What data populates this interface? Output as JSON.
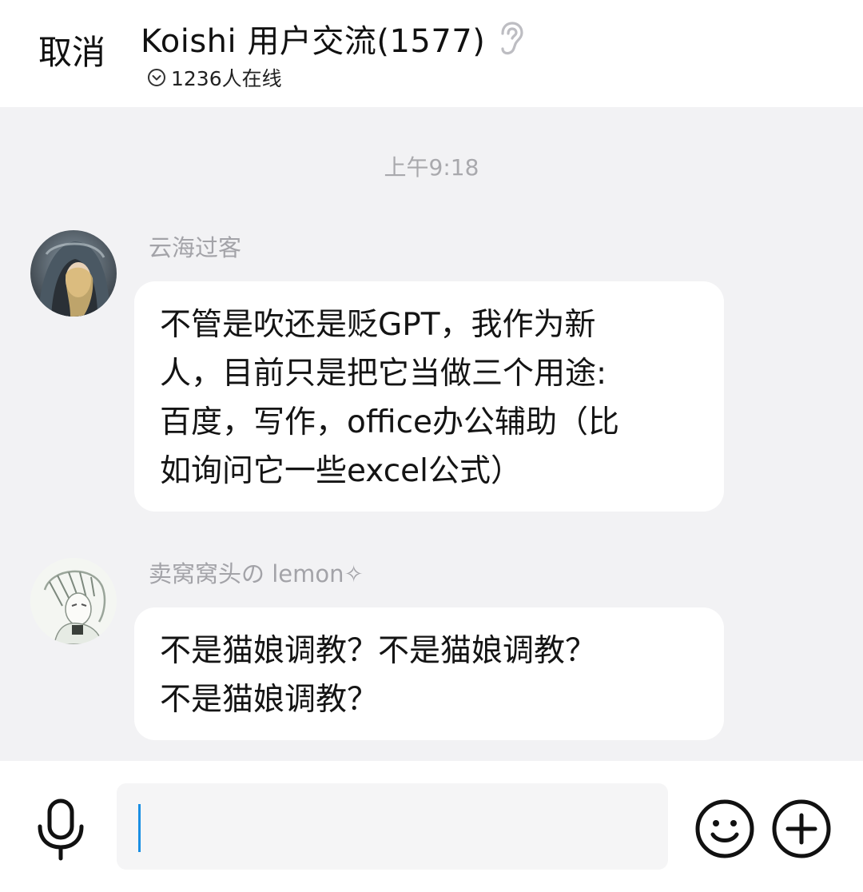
{
  "header": {
    "cancel_label": "取消",
    "title": "Koishi 用户交流(1577)",
    "online_count": "1236人在线",
    "icons": {
      "title_icon": "ear-icon",
      "online_icon": "chevron-down-circle-icon"
    }
  },
  "chat": {
    "timestamp": "上午9:18",
    "messages": [
      {
        "sender": "云海过客",
        "avatar": "avatar-hooded-figure",
        "lines": [
          "不管是吹还是贬GPT，我作为新",
          "人，目前只是把它当做三个用途:",
          "百度，写作，office办公辅助（比",
          "如询问它一些excel公式）"
        ]
      },
      {
        "sender": "卖窝窝头の lemon✧",
        "avatar": "avatar-sketch-character",
        "lines": [
          "不是猫娘调教？不是猫娘调教？",
          "不是猫娘调教？"
        ]
      }
    ]
  },
  "input_bar": {
    "text_value": "",
    "icons": {
      "voice": "microphone-icon",
      "emoji": "emoji-icon",
      "more": "plus-circle-icon"
    }
  },
  "colors": {
    "background": "#f2f2f4",
    "bubble": "#ffffff",
    "muted_text": "#a3a3a8",
    "caret": "#1a8fe3"
  }
}
